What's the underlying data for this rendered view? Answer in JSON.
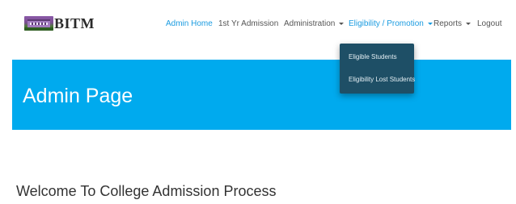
{
  "brand": {
    "text": "BITM",
    "logo_icon": "college-building-image"
  },
  "nav": {
    "items": [
      {
        "label": "Admin Home",
        "active": true,
        "has_caret": false
      },
      {
        "label": "1st Yr Admission",
        "active": false,
        "has_caret": false
      },
      {
        "label": "Administration",
        "active": false,
        "has_caret": true
      },
      {
        "label": "Eligibility / Promotion",
        "active": false,
        "has_caret": true,
        "open": true
      },
      {
        "label": "Reports",
        "active": false,
        "has_caret": true
      },
      {
        "label": "Logout",
        "active": false,
        "has_caret": false
      }
    ]
  },
  "dropdown": {
    "items": [
      {
        "label": "Eligible Students"
      },
      {
        "label": "Eligibility Lost Students"
      }
    ]
  },
  "header": {
    "title": "Admin Page"
  },
  "content": {
    "welcome": "Welcome To College Admission Process"
  },
  "colors": {
    "accent": "#1a9be0",
    "header_bg": "#00aaee",
    "dropdown_bg": "#1e4f66",
    "nav_text": "#555555"
  }
}
